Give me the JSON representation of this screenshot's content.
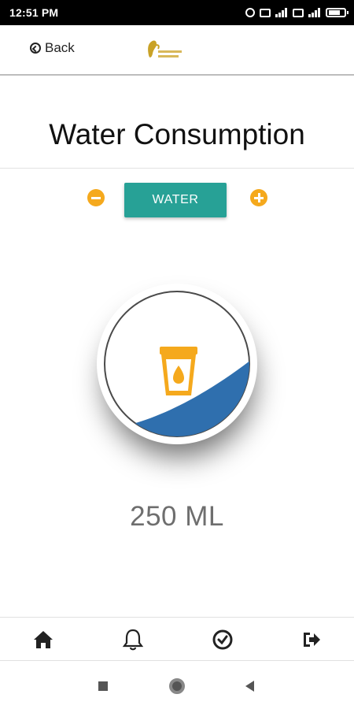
{
  "status_bar": {
    "time": "12:51 PM",
    "icons": [
      "alarm-icon",
      "sim-icon",
      "signal-icon",
      "sim-icon",
      "signal-icon",
      "battery-icon"
    ],
    "battery_level": 0.75
  },
  "header": {
    "back_label": "Back",
    "logo_icon": "fitness-logo-icon"
  },
  "page": {
    "title": "Water Consumption",
    "water_button_label": "WATER",
    "amount": "250 ML",
    "fill_level": 0.3
  },
  "bottom_nav": [
    {
      "icon": "home-icon"
    },
    {
      "icon": "bell-icon"
    },
    {
      "icon": "check-circle-icon"
    },
    {
      "icon": "logout-icon"
    }
  ],
  "system_nav": [
    "recents-icon",
    "home-circle-icon",
    "back-triangle-icon"
  ],
  "colors": {
    "accent_orange": "#f5a91d",
    "button_teal": "#27a196",
    "water_blue": "#2f6fae",
    "text_gray": "#6e6e6e"
  }
}
